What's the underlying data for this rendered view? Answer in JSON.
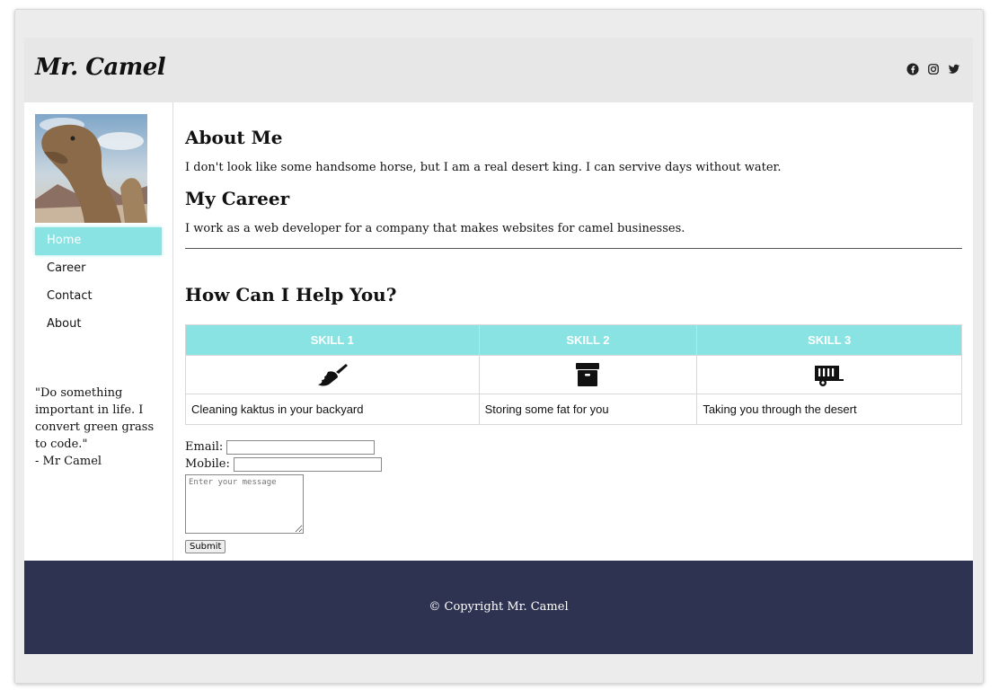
{
  "header": {
    "logo": "Mr. Camel",
    "social_icons": [
      "facebook-icon",
      "instagram-icon",
      "twitter-icon"
    ]
  },
  "sidebar": {
    "nav": [
      "Home",
      "Career",
      "Contact",
      "About"
    ],
    "active_item": "Home",
    "quote": "\"Do something important in life. I convert green grass to code.\"",
    "quote_author": "- Mr Camel"
  },
  "main": {
    "about_title": "About Me",
    "about_text": "I don't look like some handsome horse, but I am a real desert king. I can servive days without water.",
    "career_title": "My Career",
    "career_text": "I work as a web developer for a company that makes websites for camel businesses.",
    "help_title": "How Can I Help You?",
    "skills": {
      "headers": [
        "SKILL 1",
        "SKILL 2",
        "SKILL 3"
      ],
      "icons": [
        "broom-icon",
        "archive-box-icon",
        "trailer-icon"
      ],
      "descriptions": [
        "Cleaning kaktus in your backyard",
        "Storing some fat for you",
        "Taking you through the desert"
      ]
    }
  },
  "form": {
    "email_label": "Email:",
    "mobile_label": "Mobile:",
    "message_placeholder": "Enter your message",
    "submit_label": "Submit"
  },
  "footer": {
    "copyright": "© Copyright Mr. Camel"
  },
  "colors": {
    "accent": "#8ae3e3",
    "footer_bg": "#2f3352",
    "header_bg": "#e7e7e7"
  }
}
